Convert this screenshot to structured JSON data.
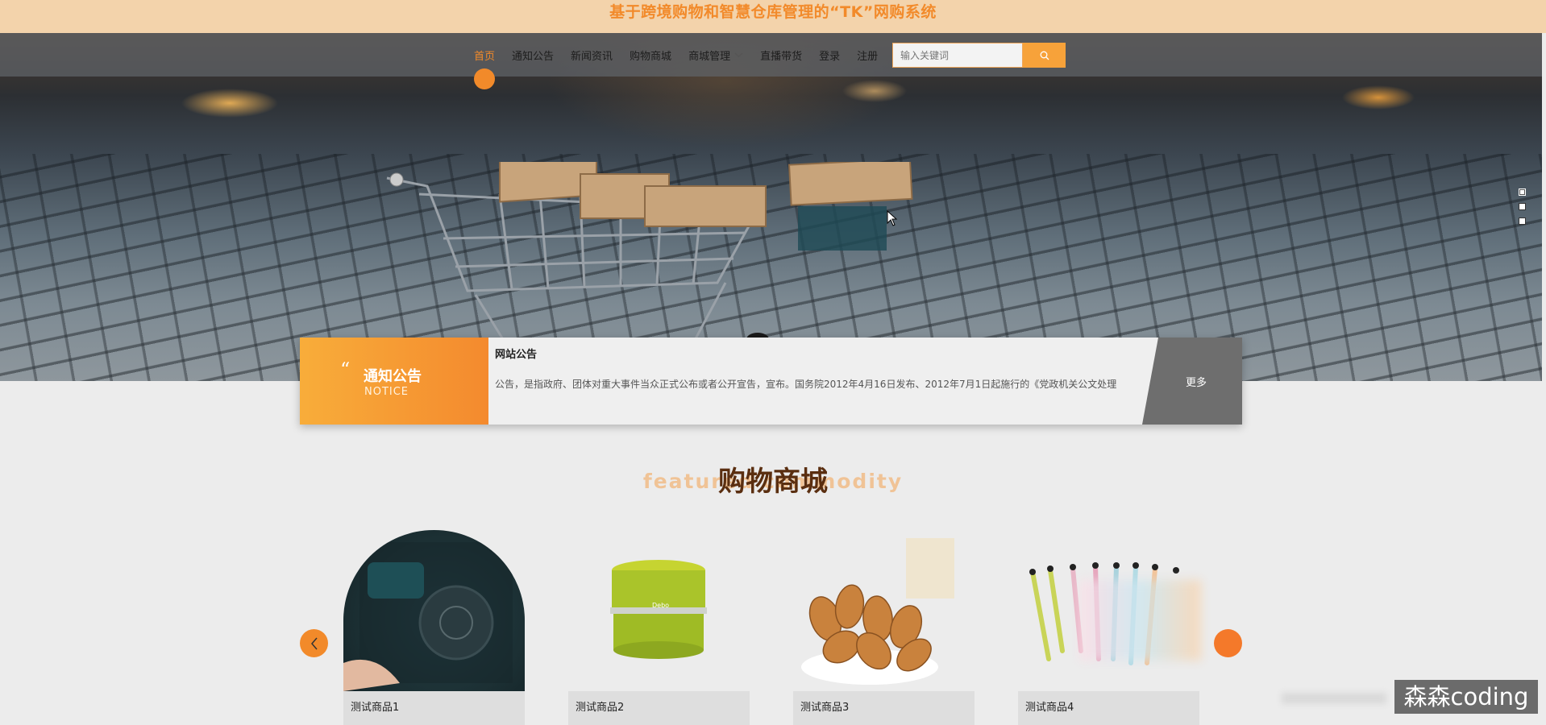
{
  "site_title": "基于跨境购物和智慧仓库管理的“TK”网购系统",
  "nav": {
    "items": [
      {
        "label": "首页",
        "active": true
      },
      {
        "label": "通知公告"
      },
      {
        "label": "新闻资讯"
      },
      {
        "label": "购物商城"
      },
      {
        "label": "商城管理",
        "has_dropdown": true
      },
      {
        "label": "直播带货"
      },
      {
        "label": "登录"
      },
      {
        "label": "注册"
      }
    ],
    "search_placeholder": "输入关键词"
  },
  "carousel": {
    "slides": 3,
    "active": 1
  },
  "notice": {
    "title": "通知公告",
    "subtitle": "NOTICE",
    "headline": "网站公告",
    "text": "公告，是指政府、团体对重大事件当众正式公布或者公开宣告，宣布。国务院2012年4月16日发布、2012年7月1日起施行的《党政机关公文处理",
    "more_label": "更多"
  },
  "mall": {
    "title": "购物商城",
    "bg_text": "featured commodity",
    "products": [
      {
        "name": "测试商品1"
      },
      {
        "name": "测试商品2"
      },
      {
        "name": "测试商品3"
      },
      {
        "name": "测试商品4"
      }
    ]
  },
  "watermark": "森森coding",
  "colors": {
    "accent": "#f28a2a",
    "topbar": "#f3d3ab",
    "notice_gradient_start": "#f8ad3a"
  },
  "icons": [
    "search-icon",
    "chevron-down-icon",
    "quote-icon",
    "arrow-left-icon",
    "arrow-right-icon"
  ]
}
